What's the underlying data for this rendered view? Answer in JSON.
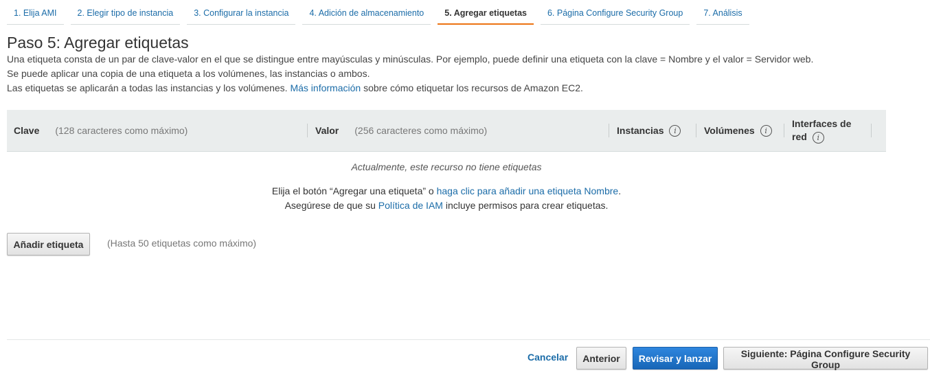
{
  "tabs": [
    {
      "label": "1. Elija AMI",
      "active": false
    },
    {
      "label": "2. Elegir tipo de instancia",
      "active": false
    },
    {
      "label": "3. Configurar la instancia",
      "active": false
    },
    {
      "label": "4. Adición de almacenamiento",
      "active": false
    },
    {
      "label": "5. Agregar etiquetas",
      "active": true
    },
    {
      "label": "6. Página Configure Security Group",
      "active": false
    },
    {
      "label": "7. Análisis",
      "active": false
    }
  ],
  "page": {
    "title": "Paso 5: Agregar etiquetas",
    "desc1": "Una etiqueta consta de un par de clave-valor en el que se distingue entre mayúsculas y minúsculas. Por ejemplo, puede definir una etiqueta con la clave = Nombre y el valor = Servidor web.",
    "desc2": "Se puede aplicar una copia de una etiqueta a los volúmenes, las instancias o ambos.",
    "desc3_pre": "Las etiquetas se aplicarán a todas las instancias y los volúmenes.",
    "desc3_link": "Más información",
    "desc3_post": "sobre cómo etiquetar los recursos de Amazon EC2."
  },
  "table": {
    "key_header": "Clave",
    "key_hint": "(128 caracteres como máximo)",
    "value_header": "Valor",
    "value_hint": "(256 caracteres como máximo)",
    "instances_header": "Instancias",
    "volumes_header": "Volúmenes",
    "network_header_1": "Interfaces de",
    "network_header_2": "red",
    "info_glyph": "i",
    "empty_message": "Actualmente, este recurso no tiene etiquetas",
    "help1_pre": "Elija el botón “Agregar una etiqueta” o",
    "help1_link": "haga clic para añadir una etiqueta Nombre",
    "help1_post": ".",
    "help2_pre": "Asegúrese de que su",
    "help2_link": "Política de IAM",
    "help2_post": "incluye permisos para crear etiquetas."
  },
  "actions": {
    "add_tag": "Añadir etiqueta",
    "add_tag_hint": "(Hasta 50 etiquetas como máximo)",
    "cancel": "Cancelar",
    "previous": "Anterior",
    "review_launch": "Revisar y lanzar",
    "next": "Siguiente: Página Configure Security Group"
  },
  "colors": {
    "link": "#1b6ca8",
    "active_tab_underline": "#ec7211",
    "primary_button": "#1866b7",
    "table_header_bg": "#eaeded"
  }
}
